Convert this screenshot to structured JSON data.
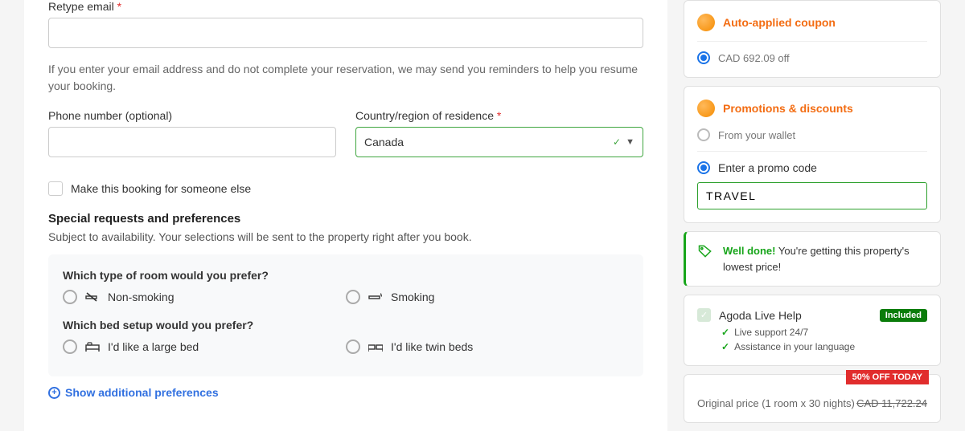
{
  "form": {
    "retypeEmail": {
      "label": "Retype email",
      "value": ""
    },
    "emailHint": "If you enter your email address and do not complete your reservation, we may send you reminders to help you resume your booking.",
    "phone": {
      "label": "Phone number (optional)",
      "value": ""
    },
    "country": {
      "label": "Country/region of residence",
      "value": "Canada"
    },
    "someoneElse": "Make this booking for someone else"
  },
  "special": {
    "title": "Special requests and preferences",
    "sub": "Subject to availability. Your selections will be sent to the property right after you book.",
    "roomQ": "Which type of room would you prefer?",
    "roomOpt1": "Non-smoking",
    "roomOpt2": "Smoking",
    "bedQ": "Which bed setup would you prefer?",
    "bedOpt1": "I'd like a large bed",
    "bedOpt2": "I'd like twin beds",
    "showMore": "Show additional preferences"
  },
  "coupon": {
    "title": "Auto-applied coupon",
    "off": "CAD 692.09 off"
  },
  "promo": {
    "title": "Promotions & discounts",
    "wallet": "From your wallet",
    "enter": "Enter a promo code",
    "code": "TRAVEL"
  },
  "welldone": {
    "bold": "Well done!",
    "rest": " You're getting this property's lowest price!"
  },
  "help": {
    "title": "Agoda Live Help",
    "badge": "Included",
    "l1": "Live support 24/7",
    "l2": "Assistance in your language"
  },
  "total": {
    "ribbon": "50% OFF TODAY",
    "line1Label": "Original price (1 room x 30 nights)",
    "line1Val": "CAD 11,722.24"
  }
}
